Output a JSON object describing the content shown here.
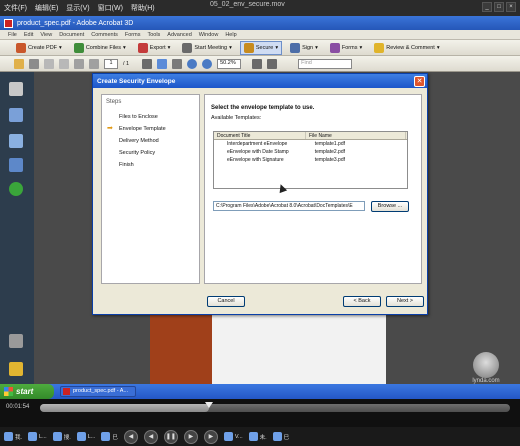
{
  "player": {
    "menu": [
      "文件(F)",
      "编辑(E)",
      "显示(V)",
      "窗口(W)",
      "帮助(H)"
    ],
    "movie_title": "05_02_env_secure.mov",
    "timecode": "00:01:54",
    "progress": 0.36
  },
  "acrobat": {
    "window_title": "product_spec.pdf - Adobe Acrobat 3D",
    "menubar": [
      "File",
      "Edit",
      "View",
      "Document",
      "Comments",
      "Forms",
      "Tools",
      "Advanced",
      "Window",
      "Help"
    ],
    "toolbar": {
      "create_pdf": "Create PDF",
      "combine_files": "Combine Files",
      "export": "Export",
      "start_meeting": "Start Meeting",
      "secure": "Secure",
      "sign": "Sign",
      "forms": "Forms",
      "review_comment": "Review & Comment"
    },
    "nav": {
      "page_current": "1",
      "page_total": "/ 1",
      "zoom": "50.2%",
      "find_placeholder": "Find"
    }
  },
  "dialog": {
    "title": "Create Security Envelope",
    "steps_header": "Steps",
    "steps": [
      "Files to Enclose",
      "Envelope Template",
      "Delivery Method",
      "Security Policy",
      "Finish"
    ],
    "current_step_marker": "➡",
    "heading": "Select the envelope template to use.",
    "available_label": "Available Templates:",
    "columns": [
      "Document Title",
      "File Name"
    ],
    "templates": [
      {
        "title": "Interdepartment eEnvelope",
        "file": "template1.pdf"
      },
      {
        "title": "eEnvelope with Date Stamp",
        "file": "template2.pdf"
      },
      {
        "title": "eEnvelope with Signature",
        "file": "template3.pdf"
      }
    ],
    "path": "C:\\Program Files\\Adobe\\Acrobat 8.0\\Acrobat\\DocTemplates\\E",
    "browse": "Browse ...",
    "cancel": "Cancel",
    "back": "< Back",
    "next": "Next >",
    "close": "✕"
  },
  "taskbar": {
    "start": "start",
    "task_item": "product_spec.pdf - A...",
    "watermark": "lynda.com",
    "tray_items": [
      "我.",
      "L...",
      "搜.",
      "L...",
      "巳",
      "V...",
      "未.",
      "巳"
    ],
    "controls": [
      "◀",
      "◀",
      "❚❚",
      "▶",
      "▶"
    ]
  }
}
